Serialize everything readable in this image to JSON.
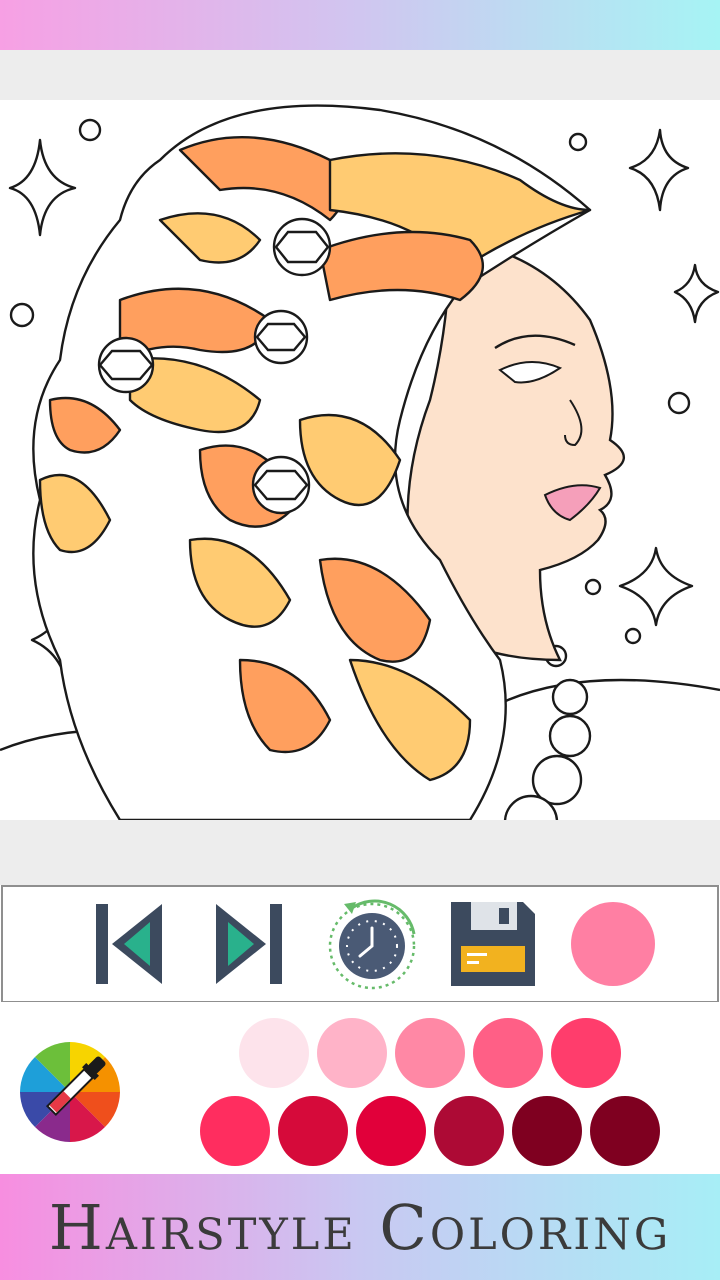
{
  "app": {
    "title": "Hairstyle Coloring"
  },
  "toolbar": {
    "buttons": [
      {
        "name": "previous-button",
        "icon": "skip-previous-icon"
      },
      {
        "name": "next-button",
        "icon": "skip-next-icon"
      },
      {
        "name": "history-button",
        "icon": "clock-history-icon"
      },
      {
        "name": "save-button",
        "icon": "floppy-disk-icon"
      },
      {
        "name": "current-color-button",
        "icon": "current-color-swatch"
      }
    ],
    "current_color": "#ff7fa3"
  },
  "palette": {
    "picker_icon": "color-wheel-dropper-icon",
    "row1": [
      "#fde3eb",
      "#ffb3c8",
      "#ff88a5",
      "#ff5f86",
      "#ff3d6c"
    ],
    "row2": [
      "#ff2d5f",
      "#d60a3a",
      "#e1003a",
      "#ad0a35",
      "#7f0020",
      "#7f0020"
    ]
  },
  "colors": {
    "hair_orange": "#ff9f5e",
    "hair_yellow": "#ffcb72",
    "skin": "#fde2cc",
    "lips": "#f59fba",
    "line": "#1a1a1a"
  }
}
